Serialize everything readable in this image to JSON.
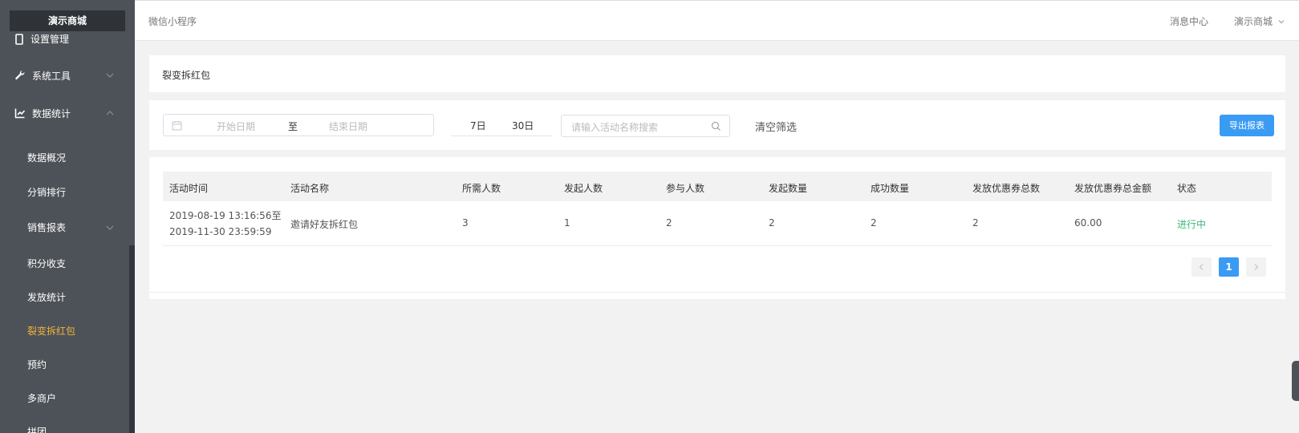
{
  "sidebar": {
    "brand": "演示商城",
    "cut_item": "设置管理",
    "menus": [
      {
        "label": "系统工具",
        "icon": "wrench-icon"
      },
      {
        "label": "数据统计",
        "icon": "line-chart-icon"
      }
    ],
    "sub_items": [
      {
        "label": "数据概况"
      },
      {
        "label": "分销排行"
      },
      {
        "label": "销售报表"
      },
      {
        "label": "积分收支"
      },
      {
        "label": "发放统计"
      },
      {
        "label": "裂变拆红包"
      },
      {
        "label": "预约"
      },
      {
        "label": "多商户"
      },
      {
        "label": "拼团"
      }
    ],
    "active_item": "裂变拆红包"
  },
  "header": {
    "breadcrumb": "微信小程序",
    "message_center": "消息中心",
    "shop": "演示商城"
  },
  "page": {
    "title": "裂变拆红包"
  },
  "filters": {
    "start_placeholder": "开始日期",
    "separator": "至",
    "end_placeholder": "结束日期",
    "quick_7": "7日",
    "quick_30": "30日",
    "search_placeholder": "请输入活动名称搜索",
    "clear": "清空筛选",
    "export": "导出报表"
  },
  "table": {
    "columns": [
      "活动时间",
      "活动名称",
      "所需人数",
      "发起人数",
      "参与人数",
      "发起数量",
      "成功数量",
      "发放优惠券总数",
      "发放优惠券总金额",
      "状态"
    ],
    "rows": [
      {
        "time_start": "2019-08-19 13:16:56至",
        "time_end": "2019-11-30 23:59:59",
        "name": "邀请好友拆红包",
        "required": "3",
        "initiators": "1",
        "participants": "2",
        "launch_count": "2",
        "success_count": "2",
        "coupon_total": "2",
        "coupon_amount": "60.00",
        "status": "进行中"
      }
    ]
  },
  "pagination": {
    "current_page": "1"
  },
  "colors": {
    "sidebar_bg": "#4d5258",
    "active": "#f0b33b",
    "primary": "#3a9bf4",
    "status_green": "#3cb878"
  }
}
